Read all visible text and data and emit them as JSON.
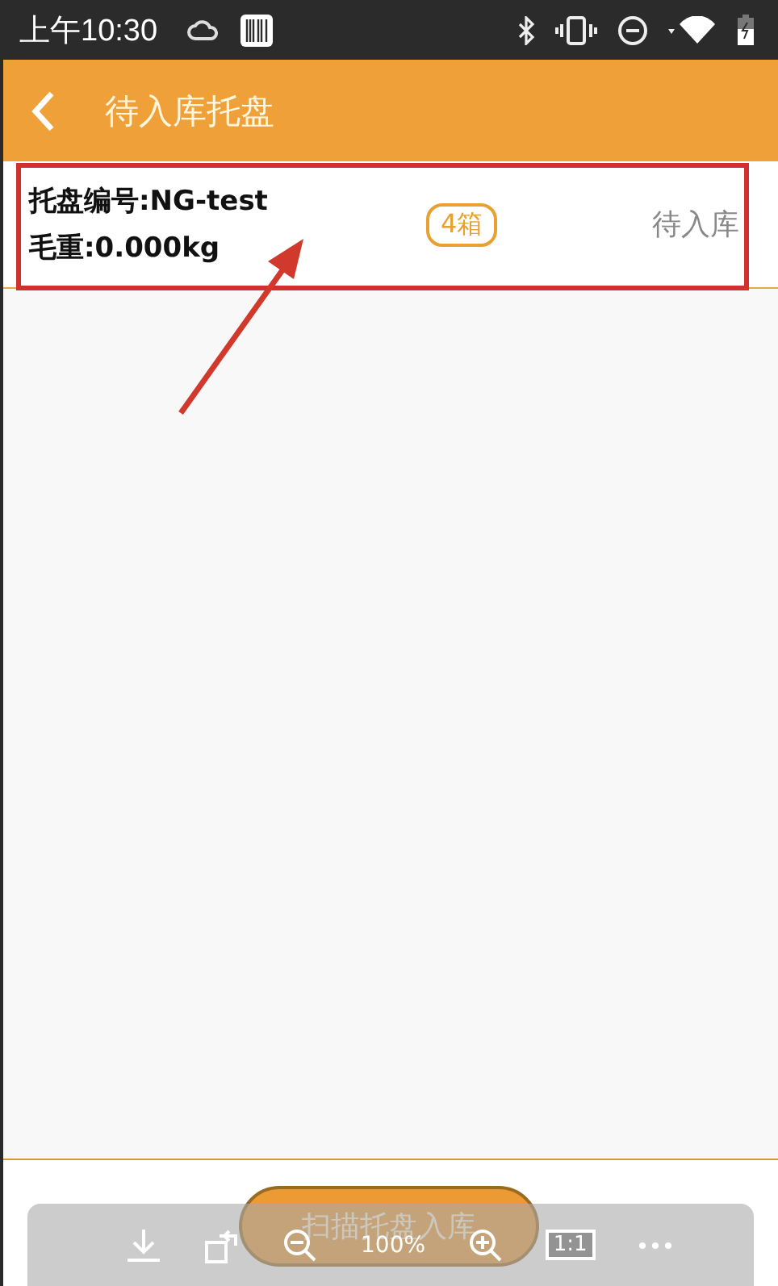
{
  "status_bar": {
    "time": "上午10:30"
  },
  "app_bar": {
    "title": "待入库托盘"
  },
  "pallets": [
    {
      "number": "托盘编号:NG-test",
      "weight": "毛重:0.000kg",
      "boxes": "4箱",
      "status": "待入库"
    }
  ],
  "scan_button": {
    "label": "扫描托盘入库"
  },
  "viewer_toolbar": {
    "zoom": "100%",
    "actual_size": "1:1"
  }
}
